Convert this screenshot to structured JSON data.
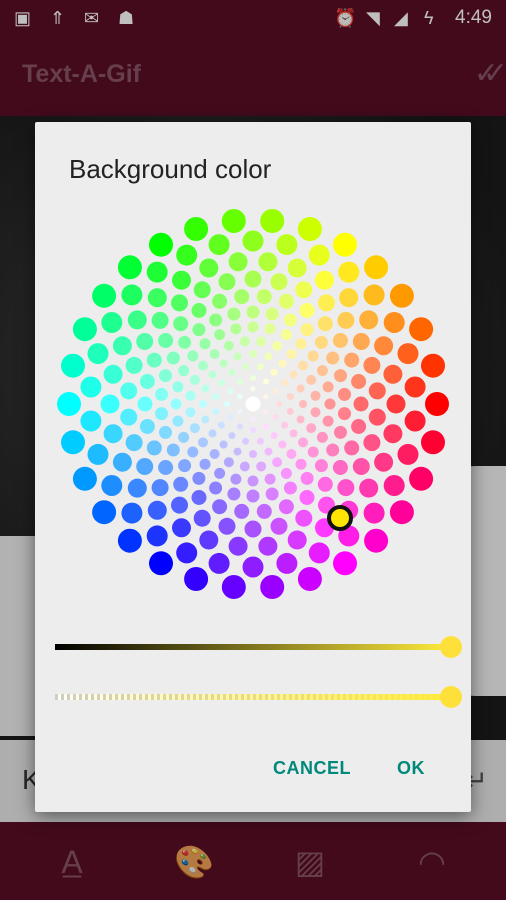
{
  "status_bar": {
    "time": "4:49",
    "icons_left": [
      "image-icon",
      "usb-icon",
      "message-icon",
      "android-debug-icon"
    ],
    "icons_right": [
      "alarm-icon",
      "wifi-icon",
      "signal-icon",
      "battery-charging-icon"
    ]
  },
  "app_bar": {
    "title": "Text-A-Gif",
    "confirm_icon": "double-check-icon"
  },
  "input_bar": {
    "text": "K"
  },
  "bottom_bar": {
    "icons": [
      "text-format-icon",
      "palette-icon",
      "gallery-icon",
      "speed-icon"
    ]
  },
  "dialog": {
    "title": "Background color",
    "selected_color": "#FFE600",
    "brightness": 1.0,
    "alpha": 1.0,
    "buttons": {
      "cancel": "CANCEL",
      "ok": "OK"
    },
    "accent_color": "#00897B"
  }
}
